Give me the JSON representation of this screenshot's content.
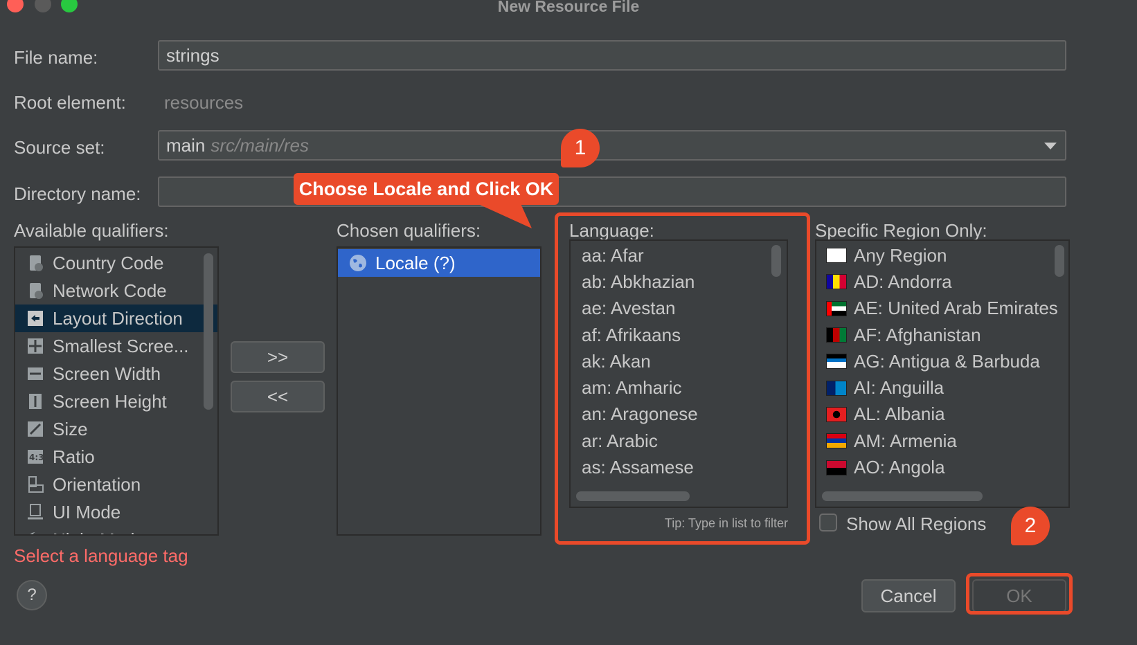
{
  "window": {
    "title": "New Resource File"
  },
  "form": {
    "file_name_label": "File name:",
    "file_name_value": "strings",
    "root_element_label": "Root element:",
    "root_element_value": "resources",
    "source_set_label": "Source set:",
    "source_set_value": "main",
    "source_set_path": "src/main/res",
    "directory_name_label": "Directory name:",
    "directory_name_value": ""
  },
  "available": {
    "label": "Available qualifiers:",
    "items": [
      {
        "label": "Country Code",
        "icon": "sim-card-icon"
      },
      {
        "label": "Network Code",
        "icon": "network-icon"
      },
      {
        "label": "Layout Direction",
        "icon": "layout-direction-icon"
      },
      {
        "label": "Smallest Scree...",
        "icon": "smallest-screen-icon"
      },
      {
        "label": "Screen Width",
        "icon": "screen-width-icon"
      },
      {
        "label": "Screen Height",
        "icon": "screen-height-icon"
      },
      {
        "label": "Size",
        "icon": "size-icon"
      },
      {
        "label": "Ratio",
        "icon": "ratio-icon"
      },
      {
        "label": "Orientation",
        "icon": "orientation-icon"
      },
      {
        "label": "UI Mode",
        "icon": "ui-mode-icon"
      },
      {
        "label": "Night Mode",
        "icon": "night-mode-icon"
      }
    ],
    "selected_index": 2
  },
  "transfer": {
    "add_label": ">>",
    "remove_label": "<<"
  },
  "chosen": {
    "label": "Chosen qualifiers:",
    "items": [
      {
        "label": "Locale (?)",
        "icon": "globe-icon"
      }
    ]
  },
  "language": {
    "label": "Language:",
    "items": [
      "aa: Afar",
      "ab: Abkhazian",
      "ae: Avestan",
      "af: Afrikaans",
      "ak: Akan",
      "am: Amharic",
      "an: Aragonese",
      "ar: Arabic",
      "as: Assamese"
    ],
    "tip": "Tip: Type in list to filter"
  },
  "region": {
    "label": "Specific Region Only:",
    "items": [
      {
        "label": "Any Region",
        "flag": [
          "#ffffff",
          "#ffffff",
          "#ffffff"
        ]
      },
      {
        "label": "AD: Andorra",
        "flag": [
          "#10069f",
          "#fedf00",
          "#d50032"
        ]
      },
      {
        "label": "AE: United Arab Emirates",
        "flag": [
          "#00732f",
          "#ffffff",
          "#000000"
        ]
      },
      {
        "label": "AF: Afghanistan",
        "flag": [
          "#000000",
          "#be0000",
          "#007a36"
        ]
      },
      {
        "label": "AG: Antigua & Barbuda",
        "flag": [
          "#ce1126",
          "#0072c6",
          "#fcd116"
        ]
      },
      {
        "label": "AI: Anguilla",
        "flag": [
          "#012169",
          "#ffffff",
          "#0085ca"
        ]
      },
      {
        "label": "AL: Albania",
        "flag": [
          "#e41e20",
          "#000000",
          "#e41e20"
        ]
      },
      {
        "label": "AM: Armenia",
        "flag": [
          "#d90012",
          "#0033a0",
          "#f2a800"
        ]
      },
      {
        "label": "AO: Angola",
        "flag": [
          "#cc092f",
          "#000000",
          "#ffcb00"
        ]
      }
    ],
    "show_all_label": "Show All Regions"
  },
  "error_text": "Select a language tag",
  "buttons": {
    "help": "?",
    "cancel": "Cancel",
    "ok": "OK"
  },
  "annotations": {
    "callout_text": "Choose Locale and Click OK",
    "badge_1": "1",
    "badge_2": "2",
    "accent_color": "#ea4a2a"
  }
}
